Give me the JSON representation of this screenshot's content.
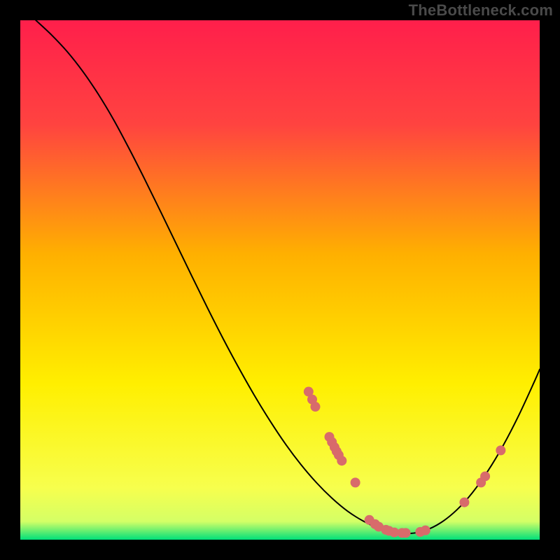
{
  "watermark": "TheBottleneck.com",
  "chart_data": {
    "type": "line",
    "title": "",
    "xlabel": "",
    "ylabel": "",
    "xlim": [
      0,
      100
    ],
    "ylim": [
      0,
      100
    ],
    "gradient_stops": [
      {
        "offset": 0.0,
        "color": "#ff1f4b"
      },
      {
        "offset": 0.2,
        "color": "#ff4340"
      },
      {
        "offset": 0.45,
        "color": "#ffb000"
      },
      {
        "offset": 0.7,
        "color": "#ffef00"
      },
      {
        "offset": 0.9,
        "color": "#f7ff4d"
      },
      {
        "offset": 0.965,
        "color": "#d4ff66"
      },
      {
        "offset": 1.0,
        "color": "#00e07a"
      }
    ],
    "curve": [
      {
        "x": 3.0,
        "y": 100.0
      },
      {
        "x": 6.0,
        "y": 97.2
      },
      {
        "x": 9.0,
        "y": 94.0
      },
      {
        "x": 12.0,
        "y": 90.2
      },
      {
        "x": 15.0,
        "y": 85.8
      },
      {
        "x": 18.0,
        "y": 80.8
      },
      {
        "x": 21.0,
        "y": 75.2
      },
      {
        "x": 24.0,
        "y": 69.3
      },
      {
        "x": 27.0,
        "y": 63.2
      },
      {
        "x": 30.0,
        "y": 57.0
      },
      {
        "x": 33.0,
        "y": 50.8
      },
      {
        "x": 36.0,
        "y": 44.7
      },
      {
        "x": 39.0,
        "y": 38.8
      },
      {
        "x": 42.0,
        "y": 33.2
      },
      {
        "x": 45.0,
        "y": 27.9
      },
      {
        "x": 48.0,
        "y": 23.0
      },
      {
        "x": 51.0,
        "y": 18.5
      },
      {
        "x": 54.0,
        "y": 14.5
      },
      {
        "x": 57.0,
        "y": 11.0
      },
      {
        "x": 60.0,
        "y": 8.0
      },
      {
        "x": 63.0,
        "y": 5.5
      },
      {
        "x": 66.0,
        "y": 3.6
      },
      {
        "x": 69.0,
        "y": 2.2
      },
      {
        "x": 72.0,
        "y": 1.4
      },
      {
        "x": 75.0,
        "y": 1.2
      },
      {
        "x": 78.0,
        "y": 1.8
      },
      {
        "x": 81.0,
        "y": 3.3
      },
      {
        "x": 84.0,
        "y": 5.7
      },
      {
        "x": 87.0,
        "y": 9.0
      },
      {
        "x": 90.0,
        "y": 13.2
      },
      {
        "x": 93.0,
        "y": 18.2
      },
      {
        "x": 96.0,
        "y": 24.0
      },
      {
        "x": 99.0,
        "y": 30.5
      },
      {
        "x": 100.0,
        "y": 32.8
      }
    ],
    "dot_color": "#d86b6b",
    "dot_radius": 7,
    "scatter": [
      {
        "x": 55.5,
        "y": 28.5
      },
      {
        "x": 56.2,
        "y": 27.0
      },
      {
        "x": 56.8,
        "y": 25.6
      },
      {
        "x": 59.5,
        "y": 19.8
      },
      {
        "x": 60.0,
        "y": 18.8
      },
      {
        "x": 60.5,
        "y": 17.8
      },
      {
        "x": 60.9,
        "y": 17.0
      },
      {
        "x": 61.3,
        "y": 16.3
      },
      {
        "x": 61.9,
        "y": 15.2
      },
      {
        "x": 64.5,
        "y": 11.0
      },
      {
        "x": 67.2,
        "y": 3.8
      },
      {
        "x": 68.3,
        "y": 3.0
      },
      {
        "x": 69.0,
        "y": 2.5
      },
      {
        "x": 70.4,
        "y": 1.9
      },
      {
        "x": 71.0,
        "y": 1.7
      },
      {
        "x": 72.0,
        "y": 1.4
      },
      {
        "x": 73.5,
        "y": 1.3
      },
      {
        "x": 74.2,
        "y": 1.3
      },
      {
        "x": 77.0,
        "y": 1.5
      },
      {
        "x": 78.0,
        "y": 1.8
      },
      {
        "x": 85.5,
        "y": 7.2
      },
      {
        "x": 88.7,
        "y": 11.0
      },
      {
        "x": 89.5,
        "y": 12.2
      },
      {
        "x": 92.5,
        "y": 17.2
      }
    ]
  }
}
